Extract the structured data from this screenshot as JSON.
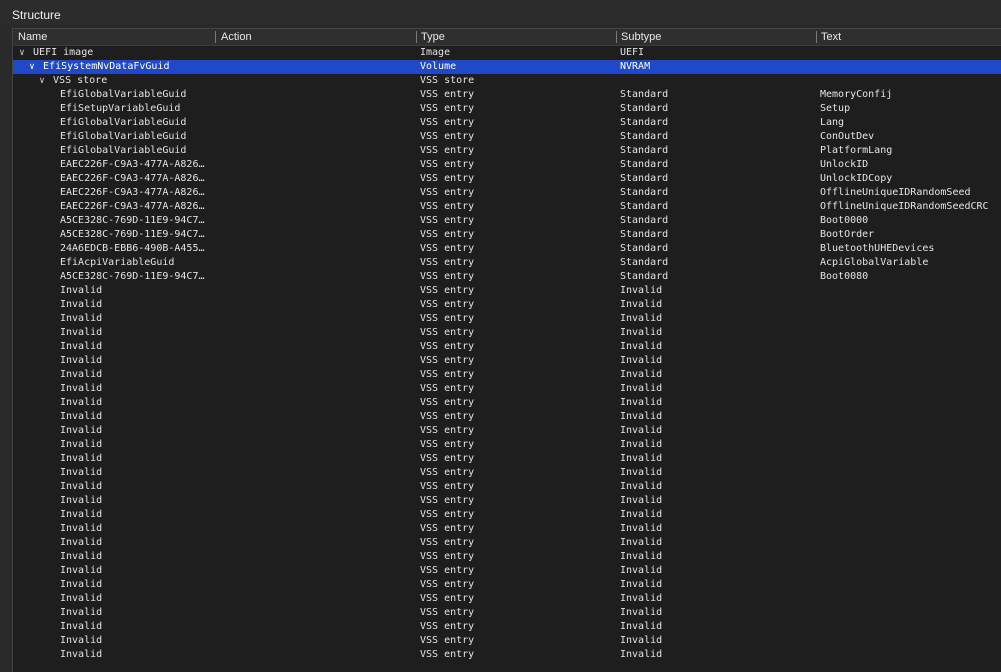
{
  "panel": {
    "title": "Structure"
  },
  "columns": {
    "name": "Name",
    "action": "Action",
    "type": "Type",
    "subtype": "Subtype",
    "text": "Text"
  },
  "icons": {
    "expanded": "chevron-down-icon"
  },
  "colors": {
    "selection": "#1f49c8",
    "background": "#1e1e1e"
  },
  "tree": {
    "root": {
      "name": "UEFI image",
      "type": "Image",
      "subtype": "UEFI",
      "text": ""
    },
    "volume": {
      "name": "EfiSystemNvDataFvGuid",
      "type": "Volume",
      "subtype": "NVRAM",
      "text": "",
      "selected": true
    },
    "store": {
      "name": "VSS store",
      "type": "VSS store",
      "subtype": "",
      "text": ""
    },
    "entries": [
      {
        "name": "EfiGlobalVariableGuid",
        "type": "VSS entry",
        "subtype": "Standard",
        "text": "MemoryConfij"
      },
      {
        "name": "EfiSetupVariableGuid",
        "type": "VSS entry",
        "subtype": "Standard",
        "text": "Setup"
      },
      {
        "name": "EfiGlobalVariableGuid",
        "type": "VSS entry",
        "subtype": "Standard",
        "text": "Lang"
      },
      {
        "name": "EfiGlobalVariableGuid",
        "type": "VSS entry",
        "subtype": "Standard",
        "text": "ConOutDev"
      },
      {
        "name": "EfiGlobalVariableGuid",
        "type": "VSS entry",
        "subtype": "Standard",
        "text": "PlatformLang"
      },
      {
        "name": "EAEC226F-C9A3-477A-A826…",
        "type": "VSS entry",
        "subtype": "Standard",
        "text": "UnlockID"
      },
      {
        "name": "EAEC226F-C9A3-477A-A826…",
        "type": "VSS entry",
        "subtype": "Standard",
        "text": "UnlockIDCopy"
      },
      {
        "name": "EAEC226F-C9A3-477A-A826…",
        "type": "VSS entry",
        "subtype": "Standard",
        "text": "OfflineUniqueIDRandomSeed"
      },
      {
        "name": "EAEC226F-C9A3-477A-A826…",
        "type": "VSS entry",
        "subtype": "Standard",
        "text": "OfflineUniqueIDRandomSeedCRC"
      },
      {
        "name": "A5CE328C-769D-11E9-94C7…",
        "type": "VSS entry",
        "subtype": "Standard",
        "text": "Boot0000"
      },
      {
        "name": "A5CE328C-769D-11E9-94C7…",
        "type": "VSS entry",
        "subtype": "Standard",
        "text": "BootOrder"
      },
      {
        "name": "24A6EDCB-EBB6-490B-A455…",
        "type": "VSS entry",
        "subtype": "Standard",
        "text": "BluetoothUHEDevices"
      },
      {
        "name": "EfiAcpiVariableGuid",
        "type": "VSS entry",
        "subtype": "Standard",
        "text": "AcpiGlobalVariable"
      },
      {
        "name": "A5CE328C-769D-11E9-94C7…",
        "type": "VSS entry",
        "subtype": "Standard",
        "text": "Boot0080"
      },
      {
        "name": "Invalid",
        "type": "VSS entry",
        "subtype": "Invalid",
        "text": ""
      },
      {
        "name": "Invalid",
        "type": "VSS entry",
        "subtype": "Invalid",
        "text": ""
      },
      {
        "name": "Invalid",
        "type": "VSS entry",
        "subtype": "Invalid",
        "text": ""
      },
      {
        "name": "Invalid",
        "type": "VSS entry",
        "subtype": "Invalid",
        "text": ""
      },
      {
        "name": "Invalid",
        "type": "VSS entry",
        "subtype": "Invalid",
        "text": ""
      },
      {
        "name": "Invalid",
        "type": "VSS entry",
        "subtype": "Invalid",
        "text": ""
      },
      {
        "name": "Invalid",
        "type": "VSS entry",
        "subtype": "Invalid",
        "text": ""
      },
      {
        "name": "Invalid",
        "type": "VSS entry",
        "subtype": "Invalid",
        "text": ""
      },
      {
        "name": "Invalid",
        "type": "VSS entry",
        "subtype": "Invalid",
        "text": ""
      },
      {
        "name": "Invalid",
        "type": "VSS entry",
        "subtype": "Invalid",
        "text": ""
      },
      {
        "name": "Invalid",
        "type": "VSS entry",
        "subtype": "Invalid",
        "text": ""
      },
      {
        "name": "Invalid",
        "type": "VSS entry",
        "subtype": "Invalid",
        "text": ""
      },
      {
        "name": "Invalid",
        "type": "VSS entry",
        "subtype": "Invalid",
        "text": ""
      },
      {
        "name": "Invalid",
        "type": "VSS entry",
        "subtype": "Invalid",
        "text": ""
      },
      {
        "name": "Invalid",
        "type": "VSS entry",
        "subtype": "Invalid",
        "text": ""
      },
      {
        "name": "Invalid",
        "type": "VSS entry",
        "subtype": "Invalid",
        "text": ""
      },
      {
        "name": "Invalid",
        "type": "VSS entry",
        "subtype": "Invalid",
        "text": ""
      },
      {
        "name": "Invalid",
        "type": "VSS entry",
        "subtype": "Invalid",
        "text": ""
      },
      {
        "name": "Invalid",
        "type": "VSS entry",
        "subtype": "Invalid",
        "text": ""
      },
      {
        "name": "Invalid",
        "type": "VSS entry",
        "subtype": "Invalid",
        "text": ""
      },
      {
        "name": "Invalid",
        "type": "VSS entry",
        "subtype": "Invalid",
        "text": ""
      },
      {
        "name": "Invalid",
        "type": "VSS entry",
        "subtype": "Invalid",
        "text": ""
      },
      {
        "name": "Invalid",
        "type": "VSS entry",
        "subtype": "Invalid",
        "text": ""
      },
      {
        "name": "Invalid",
        "type": "VSS entry",
        "subtype": "Invalid",
        "text": ""
      },
      {
        "name": "Invalid",
        "type": "VSS entry",
        "subtype": "Invalid",
        "text": ""
      },
      {
        "name": "Invalid",
        "type": "VSS entry",
        "subtype": "Invalid",
        "text": ""
      },
      {
        "name": "Invalid",
        "type": "VSS entry",
        "subtype": "Invalid",
        "text": ""
      }
    ]
  }
}
